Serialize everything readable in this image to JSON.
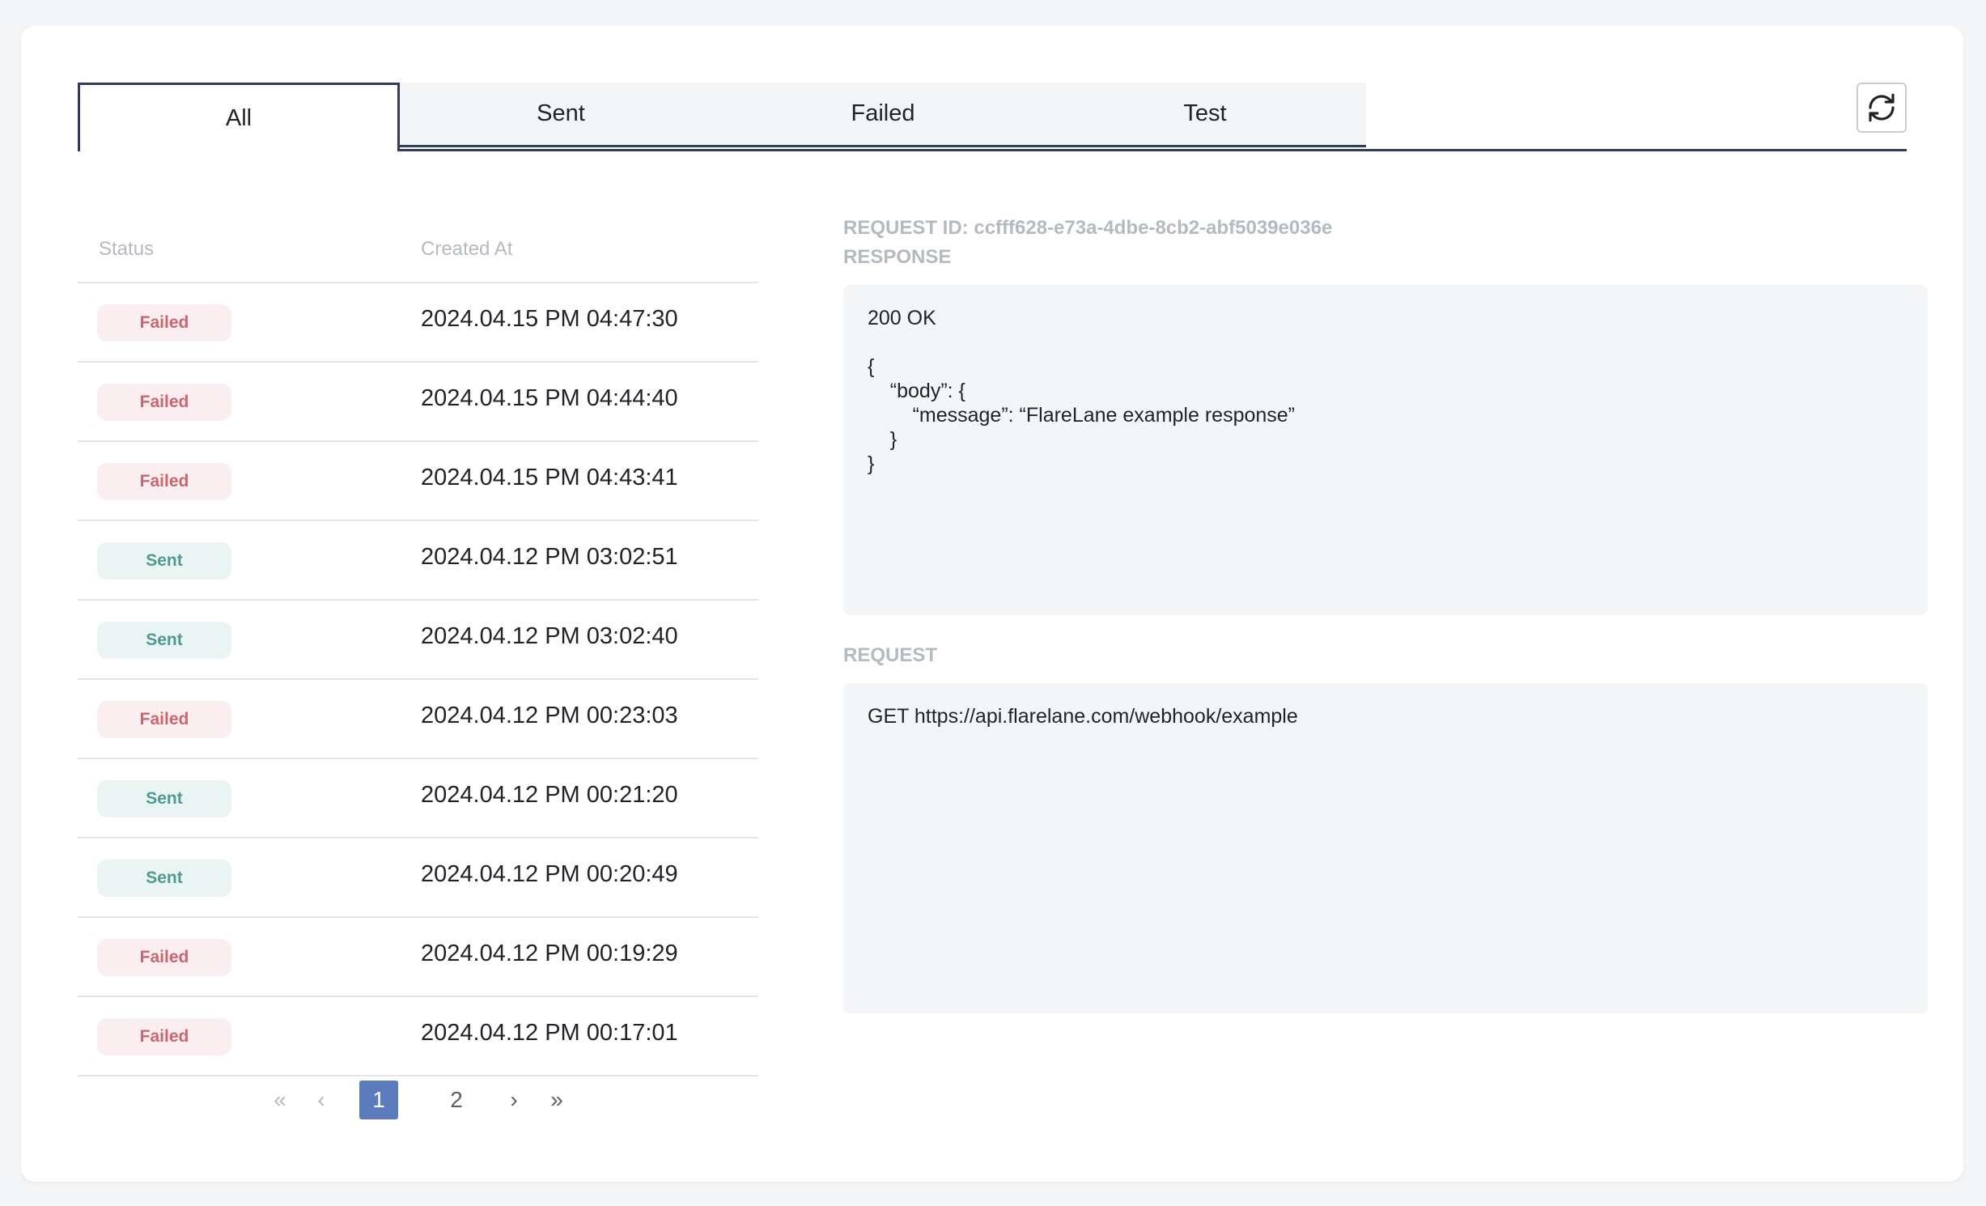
{
  "tabs": [
    {
      "label": "All",
      "active": true
    },
    {
      "label": "Sent",
      "active": false
    },
    {
      "label": "Failed",
      "active": false
    },
    {
      "label": "Test",
      "active": false
    }
  ],
  "table": {
    "columns": [
      "Status",
      "Created At"
    ],
    "rows": [
      {
        "status": "Failed",
        "created_at": "2024.04.15 PM 04:47:30"
      },
      {
        "status": "Failed",
        "created_at": "2024.04.15 PM 04:44:40"
      },
      {
        "status": "Failed",
        "created_at": "2024.04.15 PM 04:43:41"
      },
      {
        "status": "Sent",
        "created_at": "2024.04.12 PM 03:02:51"
      },
      {
        "status": "Sent",
        "created_at": "2024.04.12 PM 03:02:40"
      },
      {
        "status": "Failed",
        "created_at": "2024.04.12 PM 00:23:03"
      },
      {
        "status": "Sent",
        "created_at": "2024.04.12 PM 00:21:20"
      },
      {
        "status": "Sent",
        "created_at": "2024.04.12 PM 00:20:49"
      },
      {
        "status": "Failed",
        "created_at": "2024.04.12 PM 00:19:29"
      },
      {
        "status": "Failed",
        "created_at": "2024.04.12 PM 00:17:01"
      }
    ]
  },
  "pagination": {
    "first": "«",
    "prev": "‹",
    "pages": [
      "1",
      "2"
    ],
    "current": "1",
    "next": "›",
    "last": "»"
  },
  "detail": {
    "request_id": "REQUEST ID: ccfff628-e73a-4dbe-8cb2-abf5039e036e",
    "response_label": "RESPONSE",
    "response_body": "200 OK\n\n{\n    “body”: {\n        “message”: “FlareLane example response”\n    }\n}",
    "request_label": "REQUEST",
    "request_body": "GET https://api.flarelane.com/webhook/example"
  },
  "colors": {
    "failed_bg": "#fbeef0",
    "failed_text": "#c9676f",
    "sent_bg": "#eaf5f3",
    "sent_text": "#4f9a8e",
    "accent": "#5b7bbd",
    "tab_border": "#2f3c5c"
  },
  "icons": {
    "refresh": "refresh-icon"
  }
}
